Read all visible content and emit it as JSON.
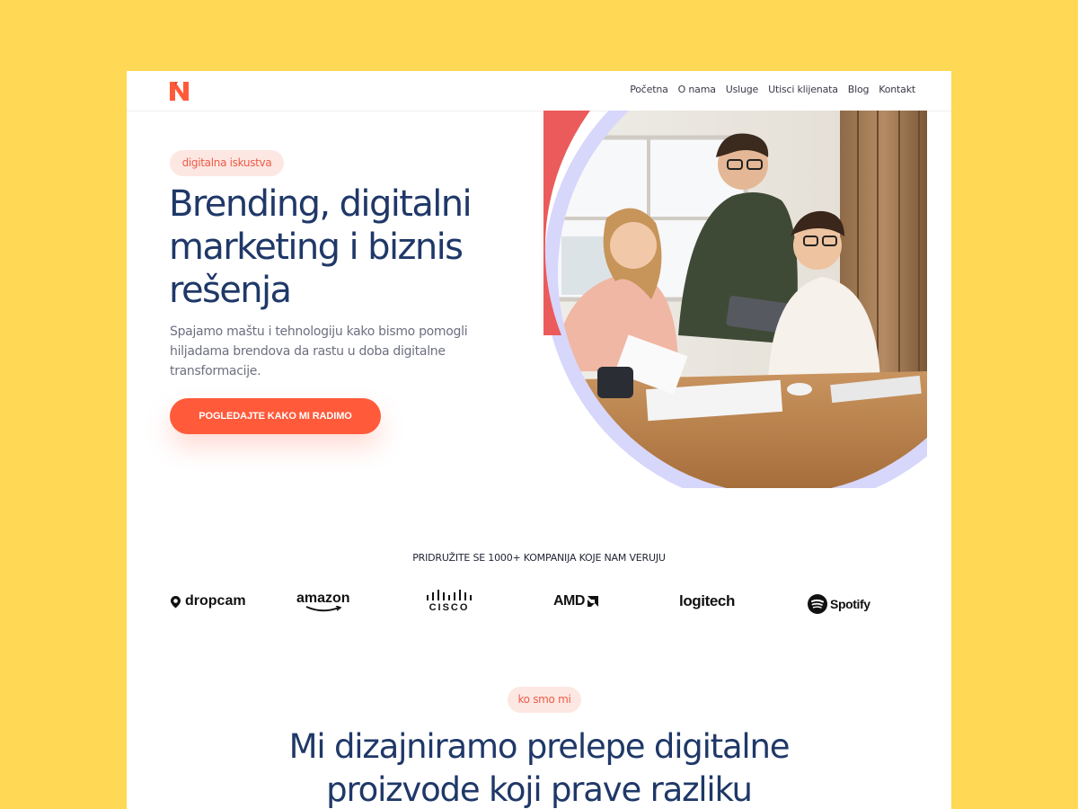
{
  "nav": {
    "logo_label": "N",
    "items": [
      "Početna",
      "O nama",
      "Usluge",
      "Utisci klijenata",
      "Blog",
      "Kontakt"
    ]
  },
  "hero": {
    "badge": "digitalna iskustva",
    "title": "Brending, digitalni marketing i biznis rešenja",
    "subtitle": "Spajamo maštu i tehnologiju kako bismo pomogli hiljadama brendova da rastu u doba digitalne transformacije.",
    "cta_label": "POGLEDAJTE KAKO MI RADIMO",
    "image_icon": "office-team-photo"
  },
  "trust": {
    "title": "PRIDRUŽITE SE 1000+ KOMPANIJA KOJE NAM VERUJU",
    "logos": [
      "dropcam",
      "amazon",
      "CISCO",
      "AMD",
      "logitech",
      "Spotify"
    ]
  },
  "about": {
    "badge": "ko smo mi",
    "title_line1": "Mi dizajniramo prelepe digitalne",
    "title_line2": "proizvode koji prave razliku"
  },
  "colors": {
    "background": "#FFD955",
    "accent": "#FF5A3A",
    "heading": "#1F3868",
    "badge_bg": "#FDE7E3",
    "arc_blue": "#D7D6FB",
    "arc_red": "#EB5B5B"
  }
}
